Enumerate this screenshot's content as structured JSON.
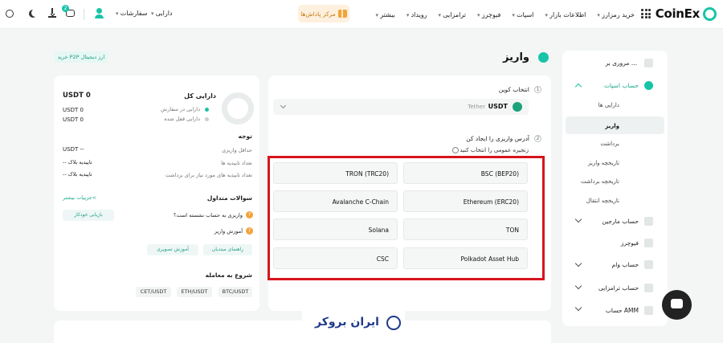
{
  "header": {
    "logo_text": "CoinEx",
    "nav": [
      "خرید رمزارز",
      "اطلاعات بازار",
      "اسپات",
      "فیوچرز",
      "ترامزایی",
      "رویداد",
      "بیشتر"
    ],
    "rewards_label": "مرکز پاداش‌ها",
    "assets_label": "دارایی",
    "orders_label": "سفارشات",
    "notification_count": "2"
  },
  "sidebar": {
    "items": [
      {
        "label": "مروری بر ...",
        "icon": "overview-icon"
      },
      {
        "label": "حساب اسپات",
        "icon": "spot-account-icon"
      },
      {
        "label": "دارایی ها"
      },
      {
        "label": "واریز"
      },
      {
        "label": "برداشت"
      },
      {
        "label": "تاریخچه واریز"
      },
      {
        "label": "تاریخچه برداشت"
      },
      {
        "label": "تاریخچه انتقال"
      },
      {
        "label": "حساب مارجین",
        "icon": "margin-icon"
      },
      {
        "label": "فیوچرز",
        "icon": "futures-icon"
      },
      {
        "label": "حساب وام",
        "icon": "loan-icon"
      },
      {
        "label": "حساب ترامزایی",
        "icon": "earn-icon"
      },
      {
        "label": "حساب AMM",
        "icon": "amm-icon"
      }
    ]
  },
  "main": {
    "title": "واریز",
    "p2p_button": "خرید P2P ارز دیجیتال",
    "step1": {
      "num": "1",
      "label": "انتخاب کوین"
    },
    "coin": {
      "symbol": "USDT",
      "name": "Tether"
    },
    "step2": {
      "num": "2",
      "label": "آدرس واریزی را ایجاد کن"
    },
    "network_hint": "زنجیره عمومی را انتخاب کنید",
    "networks": [
      "BSC (BEP20)",
      "TRON (TRC20)",
      "Ethereum (ERC20)",
      "Avalanche C-Chain",
      "TON",
      "Solana",
      "Polkadot Asset Hub",
      "CSC"
    ]
  },
  "balance": {
    "title": "دارایی کل",
    "total": "USDT 0",
    "in_order_label": "دارایی در سفارش",
    "in_order_value": "USDT 0",
    "locked_label": "دارایی قفل شده",
    "locked_value": "USDT 0",
    "notice_title": "توجه",
    "min_deposit_label": "حداقل واریزی",
    "min_deposit_value": "USDT --",
    "confirmations_label": "تعداد تاییدیه ها",
    "confirmations_value": "-- تاییدیه بلاک",
    "withdraw_conf_label": "تعداد تاییدیه های مورد نیاز برای برداشت",
    "withdraw_conf_value": "-- تاییدیه بلاک",
    "faq_title": "سوالات متداول",
    "faq_more": "جزییات بیشتر<",
    "faq1": "واریزی به حساب نشسته است؟",
    "faq1_button": "بازیابی خودکار",
    "faq2": "آموزش واریز",
    "guide_button": "راهنمای مبتدیان",
    "video_button": "آموزش تصویری",
    "trade_title": "شروع به معامله",
    "pairs": [
      "BTC/USDT",
      "ETH/USDT",
      "CET/USDT"
    ]
  },
  "watermark_text": "ایران بروکر"
}
